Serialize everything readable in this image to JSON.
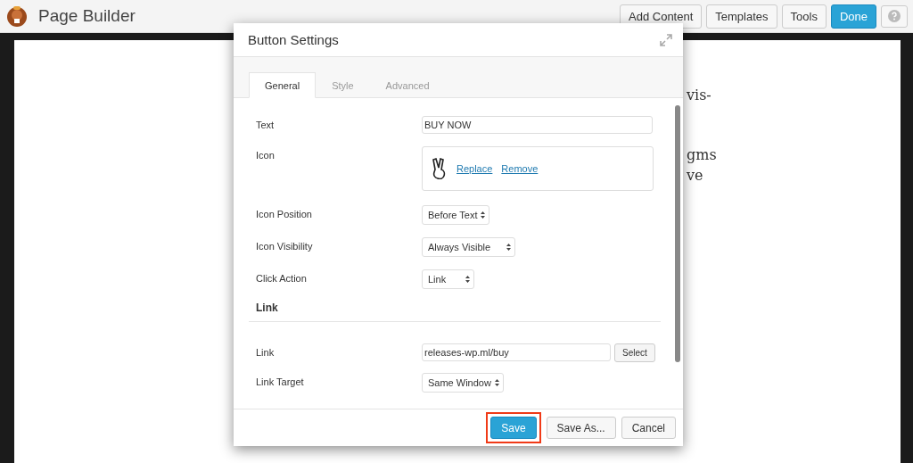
{
  "app": {
    "title": "Page Builder",
    "buttons": [
      {
        "label": "Add Content",
        "primary": false
      },
      {
        "label": "Templates",
        "primary": false
      },
      {
        "label": "Tools",
        "primary": false
      },
      {
        "label": "Done",
        "primary": true
      }
    ]
  },
  "page_text": [
    "vis-",
    "gms",
    "ve"
  ],
  "dialog": {
    "title": "Button Settings",
    "tabs": [
      {
        "label": "General",
        "selected": true
      },
      {
        "label": "Style",
        "selected": false
      },
      {
        "label": "Advanced",
        "selected": false
      }
    ],
    "fields": [
      {
        "kind": "text",
        "label": "Text",
        "value": "BUY NOW"
      },
      {
        "kind": "icon",
        "label": "Icon",
        "links": [
          "Replace",
          "Remove"
        ]
      },
      {
        "kind": "select",
        "label": "Icon Position",
        "value": "Before Text"
      },
      {
        "kind": "select",
        "label": "Icon Visibility",
        "value": "Always Visible"
      },
      {
        "kind": "select",
        "label": "Click Action",
        "value": "Link"
      },
      {
        "kind": "heading",
        "label": "Link"
      },
      {
        "kind": "link",
        "label": "Link",
        "value": "releases-wp.ml/buy",
        "button": "Select"
      },
      {
        "kind": "select",
        "label": "Link Target",
        "value": "Same Window"
      }
    ],
    "footer": [
      {
        "label": "Save",
        "primary": true,
        "highlighted": true
      },
      {
        "label": "Save As...",
        "primary": false,
        "highlighted": false
      },
      {
        "label": "Cancel",
        "primary": false,
        "highlighted": false
      }
    ]
  }
}
